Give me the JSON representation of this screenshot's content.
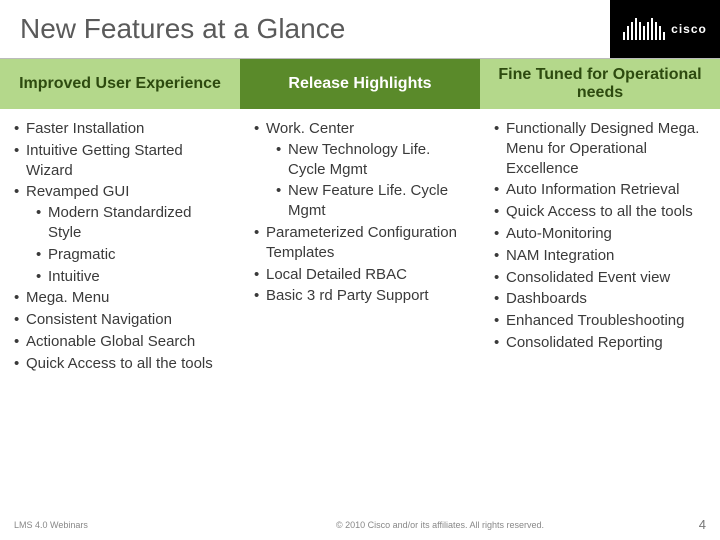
{
  "title": "New Features at a Glance",
  "logo_text": "cisco",
  "columns": [
    {
      "header": "Improved User Experience",
      "items": [
        {
          "text": "Faster Installation"
        },
        {
          "text": "Intuitive Getting Started Wizard"
        },
        {
          "text": "Revamped GUI",
          "sub": [
            {
              "text": "Modern Standardized Style"
            },
            {
              "text": "Pragmatic"
            },
            {
              "text": "Intuitive"
            }
          ]
        },
        {
          "text": "Mega. Menu"
        },
        {
          "text": "Consistent Navigation"
        },
        {
          "text": "Actionable Global Search"
        },
        {
          "text": "Quick Access to all the tools"
        }
      ]
    },
    {
      "header": "Release Highlights",
      "items": [
        {
          "text": "Work. Center",
          "sub": [
            {
              "text": "New Technology Life. Cycle Mgmt"
            },
            {
              "text": "New Feature Life. Cycle Mgmt"
            }
          ]
        },
        {
          "text": "Parameterized Configuration Templates"
        },
        {
          "text": "Local Detailed RBAC"
        },
        {
          "text": "Basic 3 rd Party Support"
        }
      ]
    },
    {
      "header": "Fine Tuned for Operational needs",
      "items": [
        {
          "text": "Functionally Designed Mega. Menu for Operational Excellence"
        },
        {
          "text": "Auto Information Retrieval"
        },
        {
          "text": "Quick Access to all the tools"
        },
        {
          "text": "Auto-Monitoring"
        },
        {
          "text": "NAM Integration"
        },
        {
          "text": "Consolidated Event view"
        },
        {
          "text": "Dashboards"
        },
        {
          "text": "Enhanced Troubleshooting"
        },
        {
          "text": "Consolidated Reporting"
        }
      ]
    }
  ],
  "footer": {
    "left": "LMS 4.0 Webinars",
    "center": "© 2010 Cisco and/or its affiliates. All rights reserved.",
    "page": "4"
  }
}
